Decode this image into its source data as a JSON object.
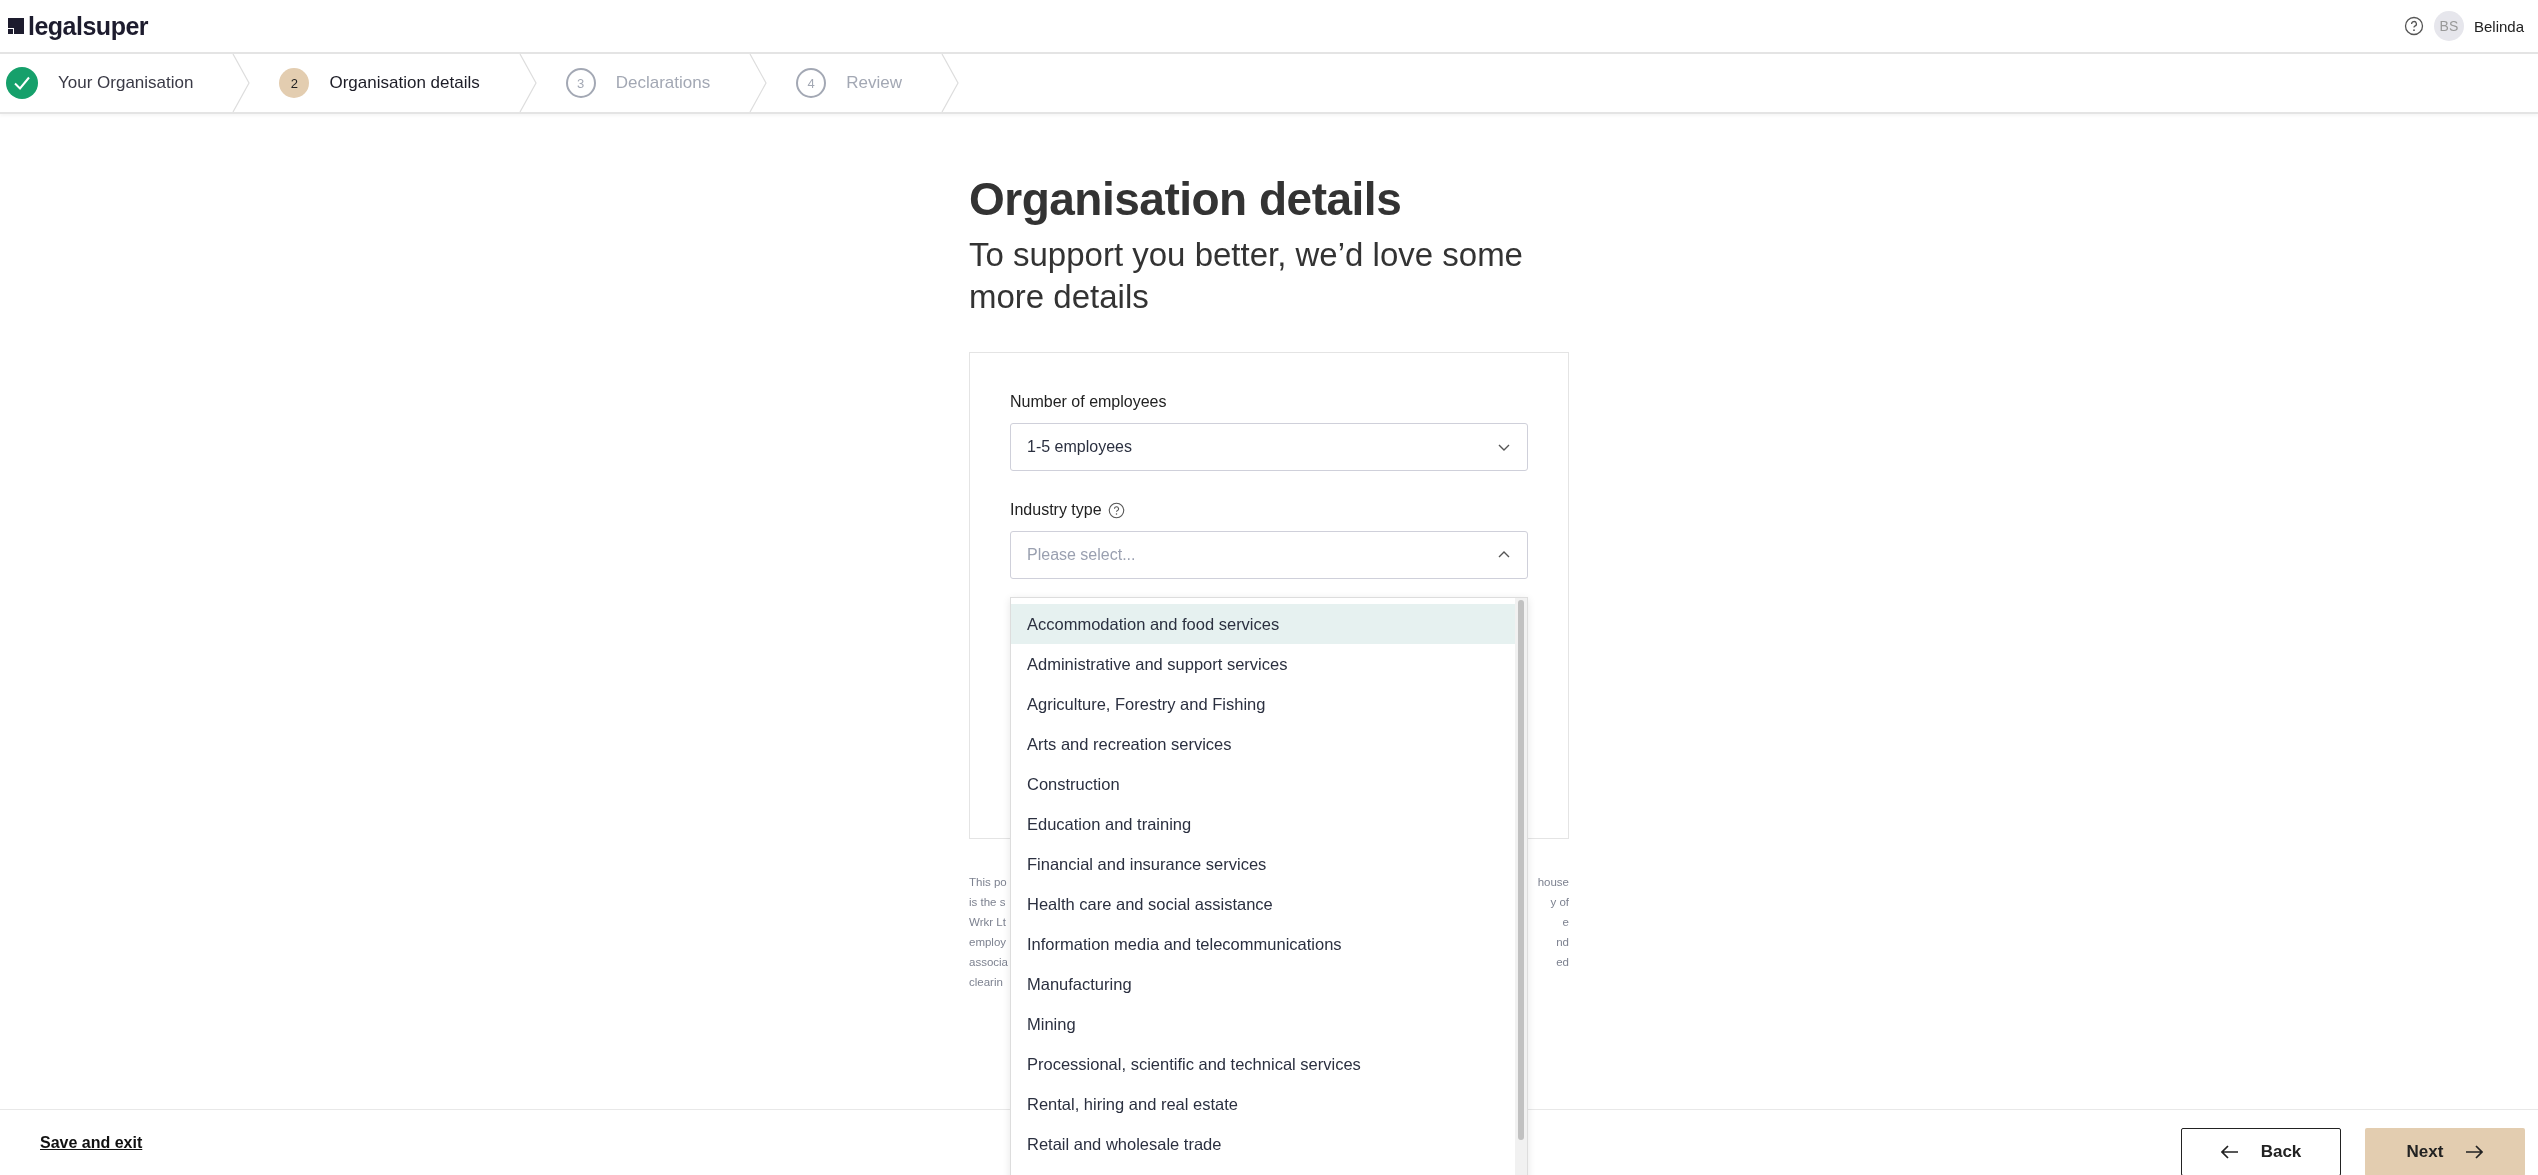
{
  "header": {
    "logo": "legalsuper",
    "user": {
      "initials": "BS",
      "name": "Belinda"
    }
  },
  "steps": [
    {
      "label": "Your Organisation",
      "complete": true,
      "selected": false
    },
    {
      "number": "2",
      "label": "Organisation details",
      "complete": false,
      "selected": true
    },
    {
      "number": "3",
      "label": "Declarations",
      "complete": false,
      "selected": false
    },
    {
      "number": "4",
      "label": "Review",
      "complete": false,
      "selected": false
    }
  ],
  "page": {
    "title": "Organisation details",
    "subtitle": "To support you better, we’d love some more details"
  },
  "form": {
    "employees": {
      "label": "Number of employees",
      "value": "1-5 employees",
      "expanded": false
    },
    "industry": {
      "label": "Industry type",
      "placeholder": "Please select...",
      "expanded": true,
      "options": [
        {
          "label": "Accommodation and food services",
          "selected": true
        },
        {
          "label": "Administrative and support services",
          "selected": false
        },
        {
          "label": "Agriculture, Forestry and Fishing",
          "selected": false
        },
        {
          "label": "Arts and recreation services",
          "selected": false
        },
        {
          "label": "Construction",
          "selected": false
        },
        {
          "label": "Education and training",
          "selected": false
        },
        {
          "label": "Financial and insurance services",
          "selected": false
        },
        {
          "label": "Health care and social assistance",
          "selected": false
        },
        {
          "label": "Information media and telecommunications",
          "selected": false
        },
        {
          "label": "Manufacturing",
          "selected": false
        },
        {
          "label": "Mining",
          "selected": false
        },
        {
          "label": "Processional, scientific and technical services",
          "selected": false
        },
        {
          "label": "Rental, hiring and real estate",
          "selected": false
        },
        {
          "label": "Retail and wholesale trade",
          "selected": false
        }
      ]
    }
  },
  "disclaimer_lines": [
    {
      "left": "This po",
      "right": "house"
    },
    {
      "left": "is the s",
      "right": "y of"
    },
    {
      "left": "Wrkr Lt",
      "right": "e"
    },
    {
      "left": "employ",
      "right": "nd"
    },
    {
      "left": "associa",
      "right": "ed"
    },
    {
      "left": "clearin"
    }
  ],
  "footer": {
    "save_link": "Save and exit",
    "back": "Back",
    "next": "Next"
  }
}
